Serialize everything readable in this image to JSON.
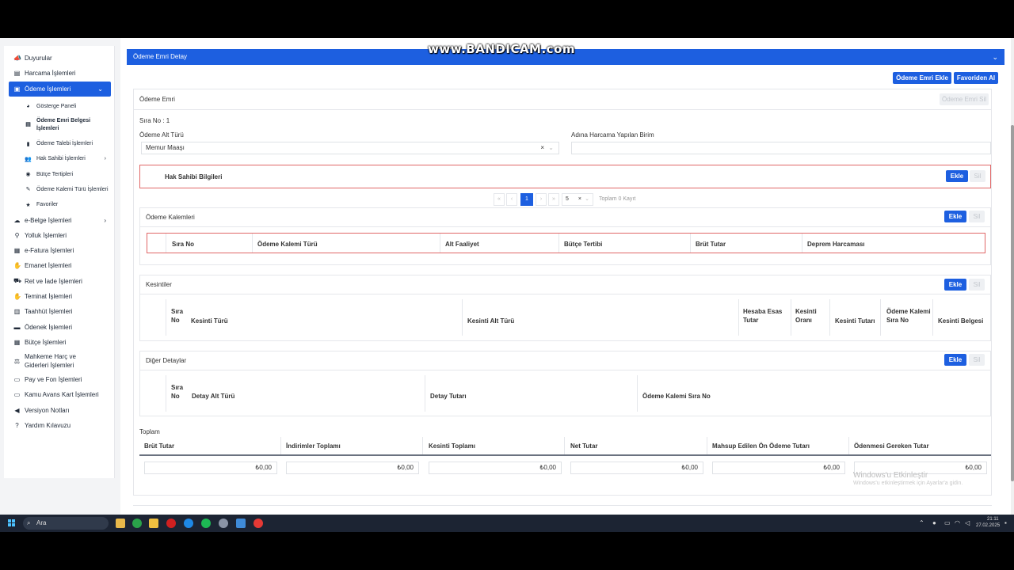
{
  "watermark": "www.BANDICAM.com",
  "sidebar": {
    "items": [
      {
        "label": "Duyurular",
        "icon": "megaphone-icon",
        "glyph": "📣"
      },
      {
        "label": "Harcama İşlemleri",
        "icon": "document-icon",
        "glyph": "▤"
      },
      {
        "label": "Ödeme İşlemleri",
        "icon": "money-icon",
        "glyph": "▣",
        "active": true
      },
      {
        "label": "e-Belge İşlemleri",
        "icon": "cloud-icon",
        "glyph": "☁"
      },
      {
        "label": "Yolluk İşlemleri",
        "icon": "route-icon",
        "glyph": "⚲"
      },
      {
        "label": "e-Fatura İşlemleri",
        "icon": "invoice-icon",
        "glyph": "▦"
      },
      {
        "label": "Emanet İşlemleri",
        "icon": "handshake-icon",
        "glyph": "✋"
      },
      {
        "label": "Ret ve İade İşlemleri",
        "icon": "truck-icon",
        "glyph": "⛟"
      },
      {
        "label": "Teminat İşlemleri",
        "icon": "hand-coin-icon",
        "glyph": "✋"
      },
      {
        "label": "Taahhüt İşlemleri",
        "icon": "contract-icon",
        "glyph": "▥"
      },
      {
        "label": "Ödenek İşlemleri",
        "icon": "wallet-icon",
        "glyph": "▬"
      },
      {
        "label": "Bütçe İşlemleri",
        "icon": "calculator-icon",
        "glyph": "▦"
      },
      {
        "label": "Mahkeme Harç ve Giderleri İşlemleri",
        "icon": "scale-icon",
        "glyph": "⚖"
      },
      {
        "label": "Pay ve Fon İşlemleri",
        "icon": "card-icon",
        "glyph": "▭"
      },
      {
        "label": "Kamu Avans Kart İşlemleri",
        "icon": "credit-card-icon",
        "glyph": "▭"
      },
      {
        "label": "Versiyon Notları",
        "icon": "bullhorn-icon",
        "glyph": "◀"
      },
      {
        "label": "Yardım Kılavuzu",
        "icon": "question-icon",
        "glyph": "?"
      }
    ],
    "subitems": [
      {
        "label": "Gösterge Paneli",
        "icon": "pie-chart-icon",
        "glyph": "◕"
      },
      {
        "label": "Ödeme Emri Belgesi İşlemleri",
        "icon": "list-icon",
        "glyph": "▤"
      },
      {
        "label": "Ödeme Talebi İşlemleri",
        "icon": "bookmark-icon",
        "glyph": "▮"
      },
      {
        "label": "Hak Sahibi İşlemleri",
        "icon": "users-icon",
        "glyph": "👥"
      },
      {
        "label": "Bütçe Tertipleri",
        "icon": "coin-icon",
        "glyph": "◉"
      },
      {
        "label": "Ödeme Kalemi Türü İşlemleri",
        "icon": "pen-icon",
        "glyph": "✎"
      },
      {
        "label": "Favoriler",
        "icon": "star-icon",
        "glyph": "★"
      }
    ]
  },
  "header": {
    "title": "Ödeme Emri Detay"
  },
  "actions": {
    "add_order": "Ödeme Emri Ekle",
    "favorites": "Favoriden Al",
    "delete_order": "Ödeme Emri Sil"
  },
  "order": {
    "section_title": "Ödeme Emri",
    "sira_no": "Sıra No : 1",
    "alt_turu_label": "Ödeme Alt Türü",
    "alt_turu_value": "Memur Maaşı",
    "birim_label": "Adına Harcama Yapılan Birim",
    "birim_value": ""
  },
  "hak_sahibi": {
    "title": "Hak Sahibi Bilgileri",
    "add": "Ekle",
    "delete": "Sil"
  },
  "pagination": {
    "first": "«",
    "prev": "‹",
    "current": "1",
    "next": "›",
    "last": "»",
    "page_size": "5",
    "total": "Toplam 0 Kayıt"
  },
  "kalemler": {
    "title": "Ödeme Kalemleri",
    "add": "Ekle",
    "delete": "Sil",
    "columns": [
      "Sıra No",
      "Ödeme Kalemi Türü",
      "Alt Faaliyet",
      "Bütçe Tertibi",
      "Brüt Tutar",
      "Deprem Harcaması"
    ]
  },
  "kesintiler": {
    "title": "Kesintiler",
    "add": "Ekle",
    "delete": "Sil",
    "columns": [
      "Sıra No",
      "Kesinti Türü",
      "Kesinti Alt Türü",
      "Hesaba Esas Tutar",
      "Kesinti Oranı",
      "Kesinti Tutarı",
      "Ödeme Kalemi Sıra No",
      "Kesinti Belgesi"
    ]
  },
  "diger": {
    "title": "Diğer Detaylar",
    "add": "Ekle",
    "delete": "Sil",
    "columns": [
      "Sıra No",
      "Detay Alt Türü",
      "Detay Tutarı",
      "Ödeme Kalemi Sıra No"
    ]
  },
  "toplam": {
    "title": "Toplam",
    "columns": [
      "Brüt Tutar",
      "İndirimler Toplamı",
      "Kesinti Toplamı",
      "Net Tutar",
      "Mahsup Edilen Ön Ödeme Tutarı",
      "Ödenmesi Gereken Tutar"
    ],
    "values": [
      "₺0,00",
      "₺0,00",
      "₺0,00",
      "₺0,00",
      "₺0,00",
      "₺0,00"
    ]
  },
  "windows_activation": {
    "title": "Windows'u Etkinleştir",
    "subtitle": "Windows'u etkinleştirmek için Ayarlar'a gidin."
  },
  "taskbar": {
    "search": "Ara",
    "time": "21:11",
    "date": "27.02.2025"
  }
}
